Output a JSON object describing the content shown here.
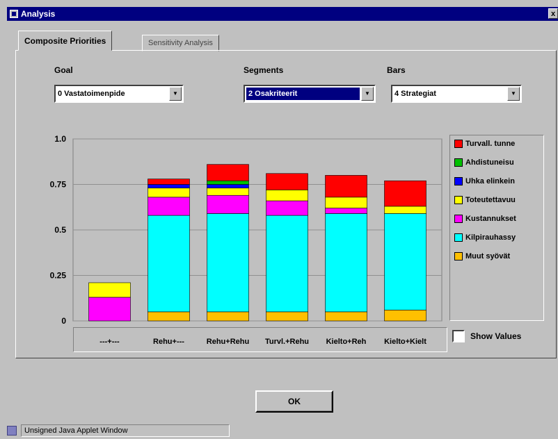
{
  "window": {
    "title": "Analysis",
    "close_label": "x"
  },
  "tabs": {
    "active": "Composite Priorities",
    "inactive": "Sensitivity Analysis"
  },
  "controls": {
    "goal_label": "Goal",
    "goal_value": "0 Vastatoimenpide",
    "segments_label": "Segments",
    "segments_value": "2 Osakriteerit",
    "bars_label": "Bars",
    "bars_value": "4 Strategiat"
  },
  "legend_title_hidden": "",
  "show_values_label": "Show Values",
  "ok_label": "OK",
  "status_text": "Unsigned Java Applet Window",
  "chart_data": {
    "type": "bar",
    "stacked": true,
    "categories": [
      "---+---",
      "Rehu+---",
      "Rehu+Rehu",
      "Turvl.+Rehu",
      "Kielto+Reh",
      "Kielto+Kielt"
    ],
    "ylim": [
      0,
      1.0
    ],
    "yticks": [
      0,
      0.25,
      0.5,
      0.75,
      1.0
    ],
    "ytick_labels": [
      "0",
      "0.25",
      "0.5",
      "0.75",
      "1.0"
    ],
    "grid": true,
    "legend_position": "right",
    "series": [
      {
        "name": "Muut syövät",
        "color": "#ffc000",
        "values": [
          0.0,
          0.05,
          0.05,
          0.05,
          0.05,
          0.06
        ]
      },
      {
        "name": "Kilpirauhassy",
        "color": "#00ffff",
        "values": [
          0.0,
          0.53,
          0.54,
          0.53,
          0.54,
          0.53
        ]
      },
      {
        "name": "Kustannukset",
        "color": "#ff00ff",
        "values": [
          0.13,
          0.1,
          0.1,
          0.08,
          0.03,
          0.0
        ]
      },
      {
        "name": "Toteutettavuu",
        "color": "#ffff00",
        "values": [
          0.08,
          0.05,
          0.04,
          0.06,
          0.06,
          0.04
        ]
      },
      {
        "name": "Uhka elinkein",
        "color": "#0000ff",
        "values": [
          0.0,
          0.02,
          0.02,
          0.0,
          0.0,
          0.0
        ]
      },
      {
        "name": "Ahdistuneisu",
        "color": "#00c000",
        "values": [
          0.0,
          0.0,
          0.02,
          0.0,
          0.0,
          0.0
        ]
      },
      {
        "name": "Turvall. tunne",
        "color": "#ff0000",
        "values": [
          0.0,
          0.03,
          0.09,
          0.09,
          0.12,
          0.14
        ]
      }
    ],
    "legend_order": [
      "Turvall. tunne",
      "Ahdistuneisu",
      "Uhka elinkein",
      "Toteutettavuu",
      "Kustannukset",
      "Kilpirauhassy",
      "Muut syövät"
    ]
  }
}
